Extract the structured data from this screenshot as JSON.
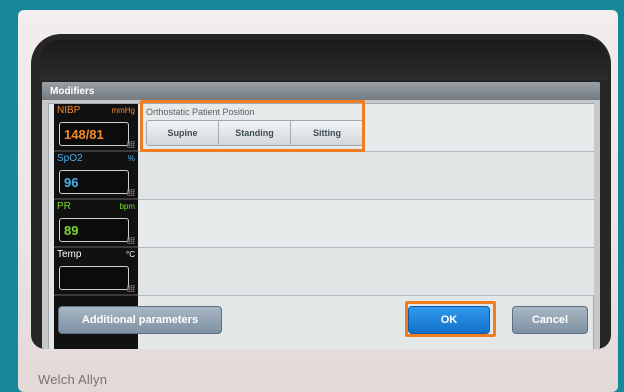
{
  "window": {
    "title": "Modifiers"
  },
  "vitals": [
    {
      "label": "NIBP",
      "unit": "mmHg",
      "value": "148/81",
      "color": "#f28a2c"
    },
    {
      "label": "SpO2",
      "unit": "%",
      "value": "96",
      "color": "#4aaef0"
    },
    {
      "label": "PR",
      "unit": "bpm",
      "value": "89",
      "color": "#7ad82a"
    },
    {
      "label": "Temp",
      "unit": "°C",
      "value": "",
      "color": "#ffffff"
    }
  ],
  "modifiers": {
    "orthostatic": {
      "label": "Orthostatic Patient Position",
      "options": [
        "Supine",
        "Standing",
        "Sitting"
      ]
    }
  },
  "buttons": {
    "additional": "Additional parameters",
    "ok": "OK",
    "cancel": "Cancel"
  },
  "device": {
    "brand": "Welch Allyn"
  },
  "colors": {
    "highlight": "#f07d21",
    "ok": "#1a7fd8",
    "background": "#17889a"
  }
}
